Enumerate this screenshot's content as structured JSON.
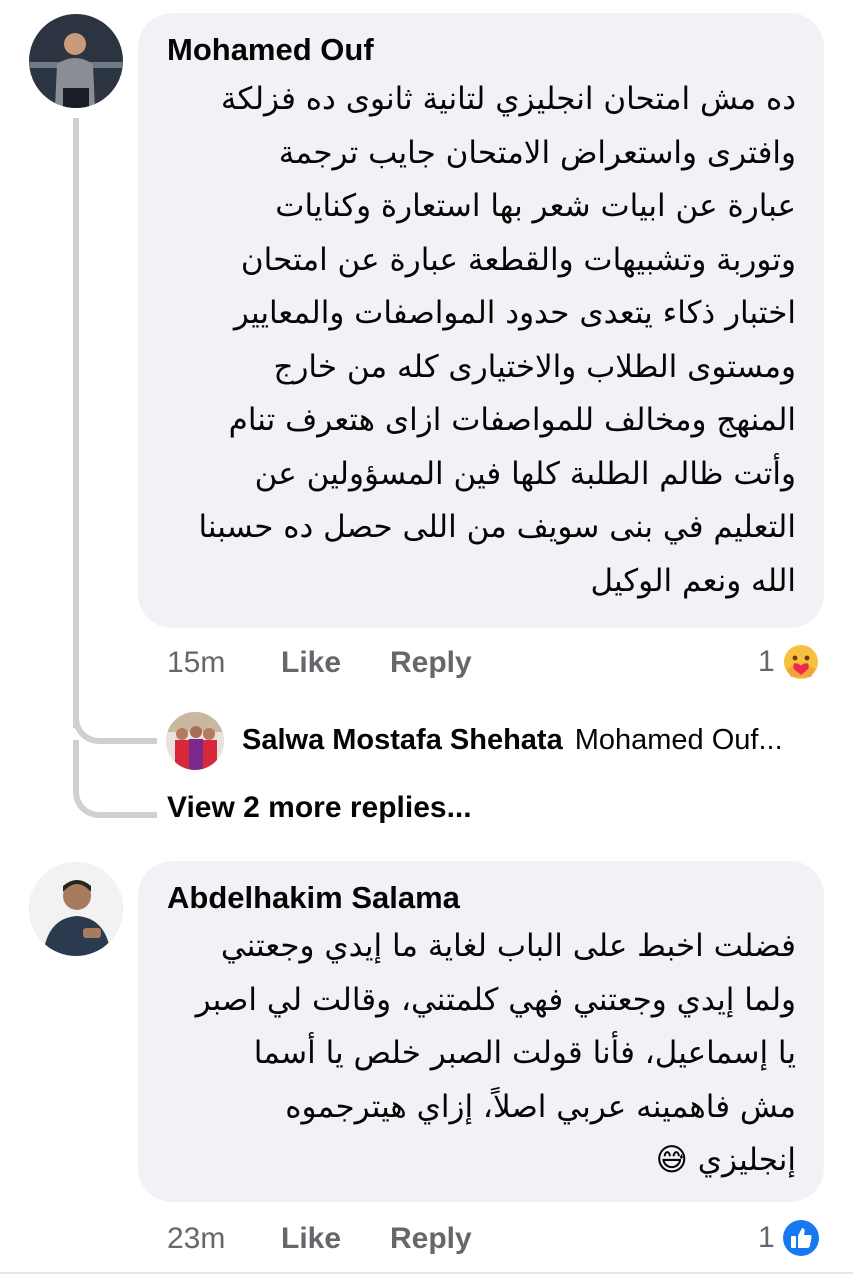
{
  "comments": [
    {
      "author": "Mohamed Ouf",
      "lines": [
        "ده مش امتحان انجليزي لتانية ثانوى ده فزلكة",
        "وافترى واستعراض الامتحان جايب ترجمة",
        "عبارة عن ابيات شعر بها استعارة وكنايات",
        "وتوربة وتشبيهات والقطعة عبارة عن امتحان",
        "اختبار ذكاء يتعدى حدود المواصفات والمعايير",
        "ومستوى الطلاب والاختيارى كله من خارج",
        "المنهج ومخالف للمواصفات ازاى هتعرف تنام",
        "وأتت ظالم الطلبة كلها فين المسؤولين عن",
        "التعليم في بنى سويف من اللى حصل ده حسبنا",
        "الله ونعم الوكيل"
      ],
      "time": "15m",
      "like_label": "Like",
      "reply_label": "Reply",
      "reaction_count": "1",
      "reaction_icon": "care-reaction-icon"
    },
    {
      "author": "Abdelhakim Salama",
      "lines": [
        "فضلت اخبط على الباب لغاية ما إيدي وجعتني",
        "ولما إيدي وجعتني فهي كلمتني، وقالت لي اصبر",
        "يا إسماعيل، فأنا قولت الصبر خلص يا أسما",
        "مش فاهمينه عربي اصلاً، إزاي هيترجموه",
        "إنجليزي"
      ],
      "emoji": "😅",
      "time": "23m",
      "like_label": "Like",
      "reply_label": "Reply",
      "reaction_count": "1",
      "reaction_icon": "like-reaction-icon"
    }
  ],
  "reply_preview": {
    "name": "Salwa Mostafa Shehata",
    "snippet": "Mohamed Ouf..."
  },
  "more_replies_label": "View 2 more replies...",
  "colors": {
    "bubble": "#f0f2f5",
    "meta_text": "#65676b",
    "like_blue": "#1877f2",
    "thread_line": "#ced0d4"
  }
}
